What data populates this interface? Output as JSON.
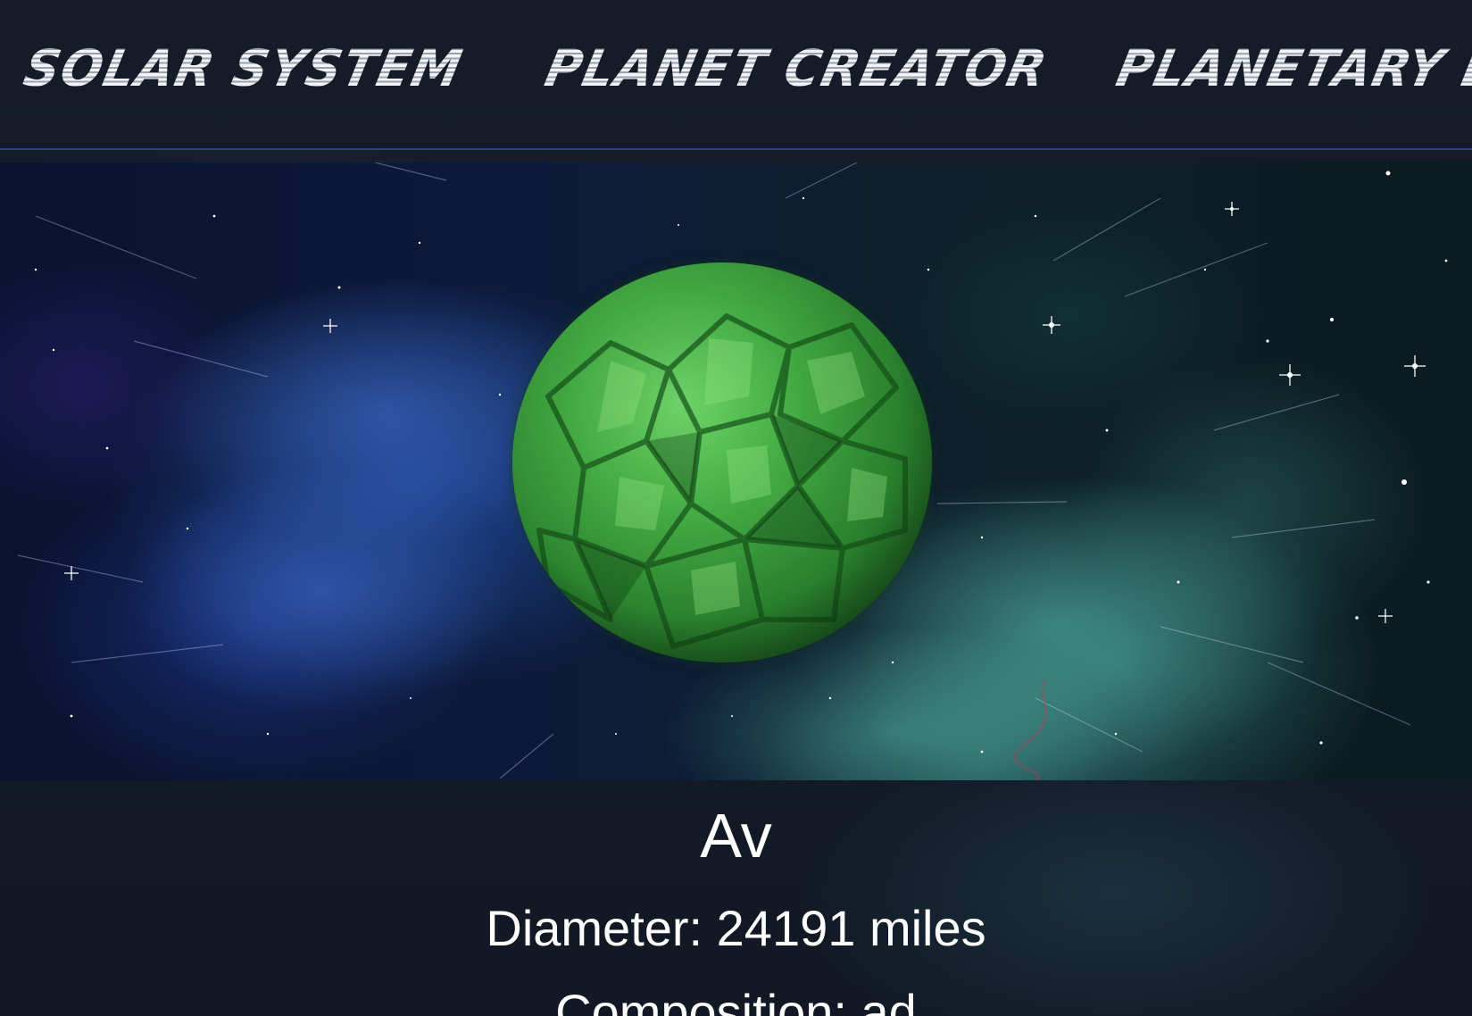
{
  "nav": {
    "solar_system": "SOLAR SYSTEM",
    "planet_creator": "PLANET CREATOR",
    "planetary_list": "PLANETARY LIST"
  },
  "planet": {
    "name": "Av",
    "diameter_label": "Diameter: 24191 miles",
    "composition_label": "Composition: ad",
    "color": "#3fa83f"
  },
  "colors": {
    "nav_background": "#151c28",
    "nav_border": "#2f3f8f",
    "page_background": "#131a26",
    "text": "#ffffff"
  }
}
